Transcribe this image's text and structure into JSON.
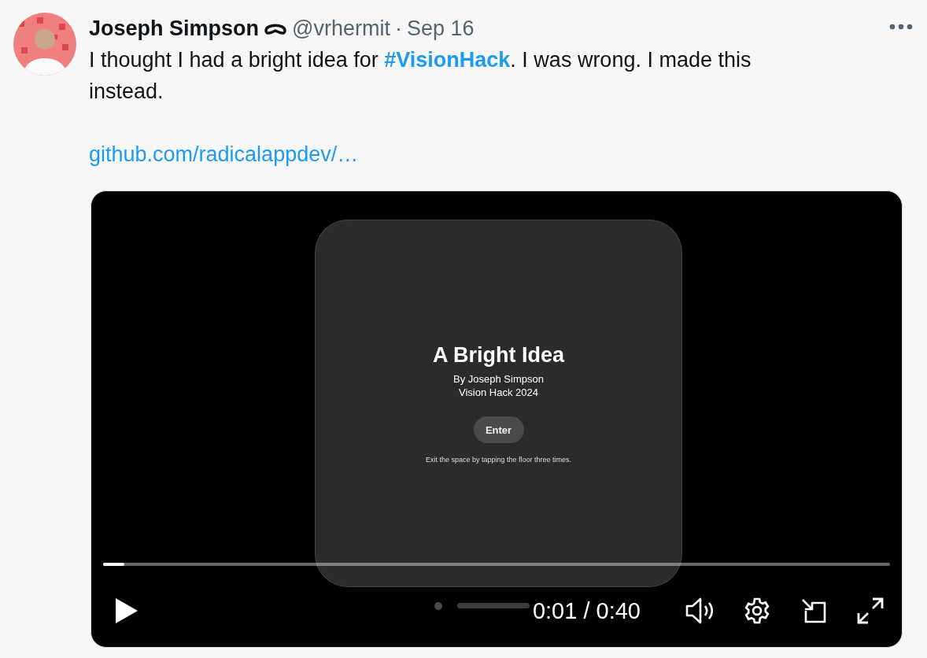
{
  "tweet": {
    "author": {
      "name": "Joseph Simpson",
      "handle": "@vrhermit",
      "separator": "·",
      "date": "Sep 16"
    },
    "body": [
      {
        "kind": "text",
        "text": "I thought I had a bright idea for "
      },
      {
        "kind": "hashtag",
        "text": "#VisionHack"
      },
      {
        "kind": "text",
        "text": ". I was wrong. I made this instead."
      }
    ],
    "link": "github.com/radicalappdev/…",
    "video": {
      "app_window": {
        "title": "A Bright Idea",
        "lines": [
          "By Joseph Simpson",
          "Vision Hack 2024"
        ],
        "button": "Enter",
        "note": "Exit the space by tapping the floor three times."
      },
      "playing": false,
      "progress": {
        "level": 0.027
      },
      "time": "0:01 / 0:40"
    }
  }
}
